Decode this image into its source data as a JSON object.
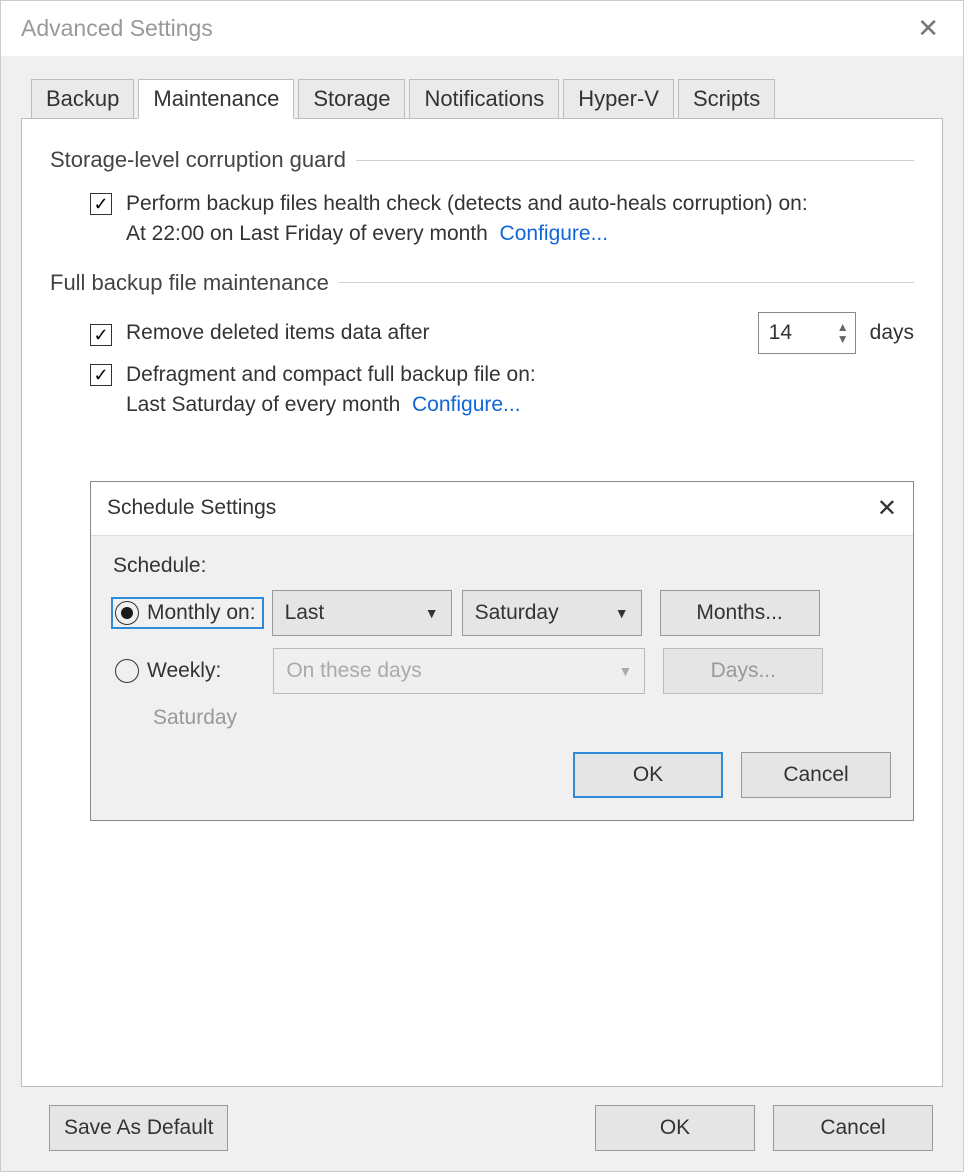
{
  "window": {
    "title": "Advanced Settings"
  },
  "tabs": [
    {
      "label": "Backup"
    },
    {
      "label": "Maintenance"
    },
    {
      "label": "Storage"
    },
    {
      "label": "Notifications"
    },
    {
      "label": "Hyper-V"
    },
    {
      "label": "Scripts"
    }
  ],
  "activeTab": 1,
  "maintenance": {
    "group1_title": "Storage-level corruption guard",
    "healthcheck_label": "Perform backup files health check (detects and auto-heals corruption) on:",
    "healthcheck_schedule": "At 22:00 on Last Friday of every month",
    "configure1": "Configure...",
    "group2_title": "Full backup file maintenance",
    "remove_label": "Remove deleted items data after",
    "remove_value": "14",
    "days_label": "days",
    "defrag_label": "Defragment and compact full backup file on:",
    "defrag_schedule": "Last Saturday of every month",
    "configure2": "Configure..."
  },
  "scheduleDialog": {
    "title": "Schedule Settings",
    "schedule_label": "Schedule:",
    "monthly_label": "Monthly on:",
    "monthly_occurrence": "Last",
    "monthly_day": "Saturday",
    "months_button": "Months...",
    "weekly_label": "Weekly:",
    "weekly_placeholder": "On these days",
    "days_button": "Days...",
    "weekly_summary": "Saturday",
    "ok": "OK",
    "cancel": "Cancel"
  },
  "footer": {
    "save_default": "Save As Default",
    "ok": "OK",
    "cancel": "Cancel"
  }
}
